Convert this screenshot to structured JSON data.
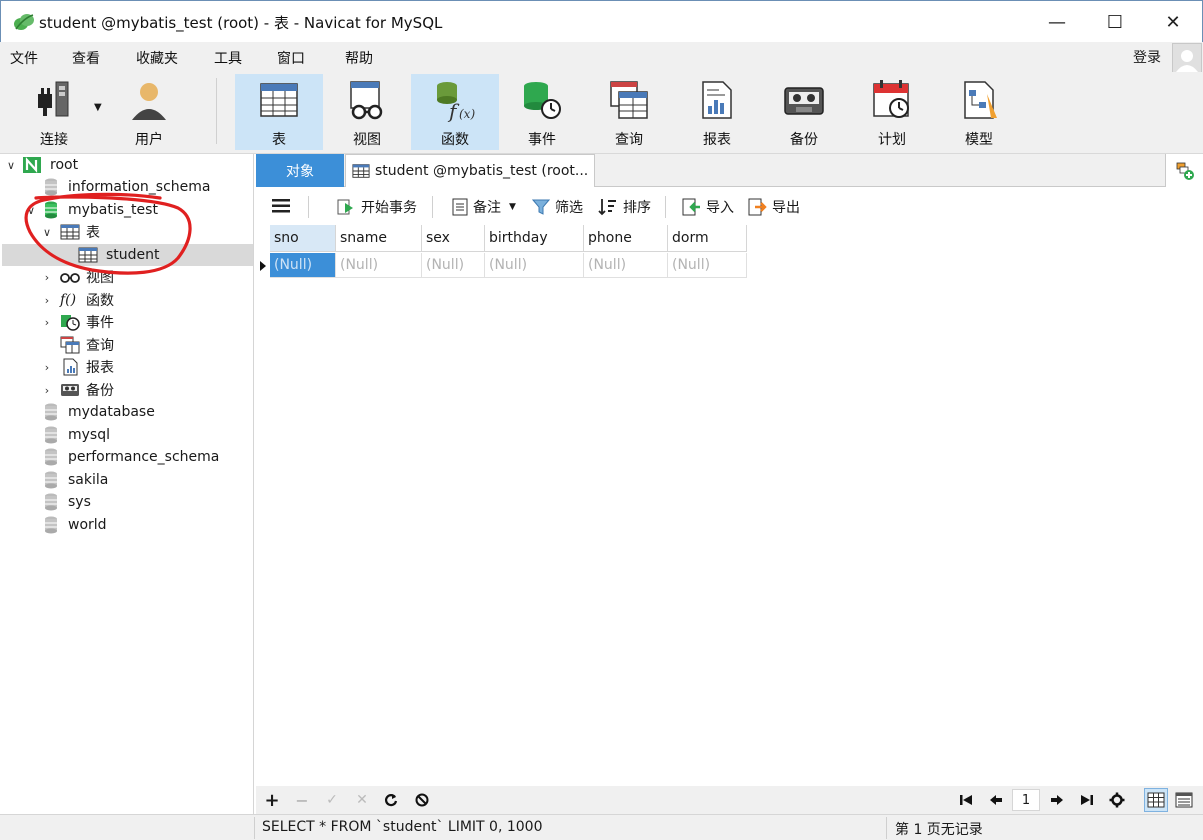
{
  "window": {
    "title": "student @mybatis_test (root) - 表 - Navicat for MySQL",
    "minimize": "—",
    "maximize": "☐",
    "close": "✕"
  },
  "menu": {
    "items": [
      "文件",
      "查看",
      "收藏夹",
      "工具",
      "窗口",
      "帮助"
    ],
    "login": "登录"
  },
  "toolbar": {
    "items": [
      "连接",
      "用户",
      "表",
      "视图",
      "函数",
      "事件",
      "查询",
      "报表",
      "备份",
      "计划",
      "模型"
    ],
    "active": "表"
  },
  "tree": {
    "root": "root",
    "databases": [
      "information_schema",
      "mybatis_test",
      "mydatabase",
      "mysql",
      "performance_schema",
      "sakila",
      "sys",
      "world"
    ],
    "children": [
      "表",
      "student",
      "视图",
      "函数",
      "事件",
      "查询",
      "报表",
      "备份"
    ]
  },
  "tabs": {
    "objects": "对象",
    "student": "student @mybatis_test (root..."
  },
  "subtoolbar": {
    "begin_tx": "开始事务",
    "note": "备注",
    "filter": "筛选",
    "sort": "排序",
    "import": "导入",
    "export": "导出"
  },
  "grid": {
    "columns": [
      "sno",
      "sname",
      "sex",
      "birthday",
      "phone",
      "dorm"
    ],
    "row": [
      "(Null)",
      "(Null)",
      "(Null)",
      "(Null)",
      "(Null)",
      "(Null)"
    ]
  },
  "nav": {
    "add": "+",
    "remove": "−",
    "apply": "✓",
    "cancel": "✕",
    "refresh": "C",
    "stop": "⊘",
    "page": "1"
  },
  "status": {
    "sql": "SELECT * FROM `student` LIMIT 0, 1000",
    "records": "第 1 页无记录"
  },
  "colors": {
    "accent": "#3c8fd8",
    "active_toolbar": "#cce4f7",
    "annotation": "#e02020",
    "db_active": "#2fa84f"
  }
}
